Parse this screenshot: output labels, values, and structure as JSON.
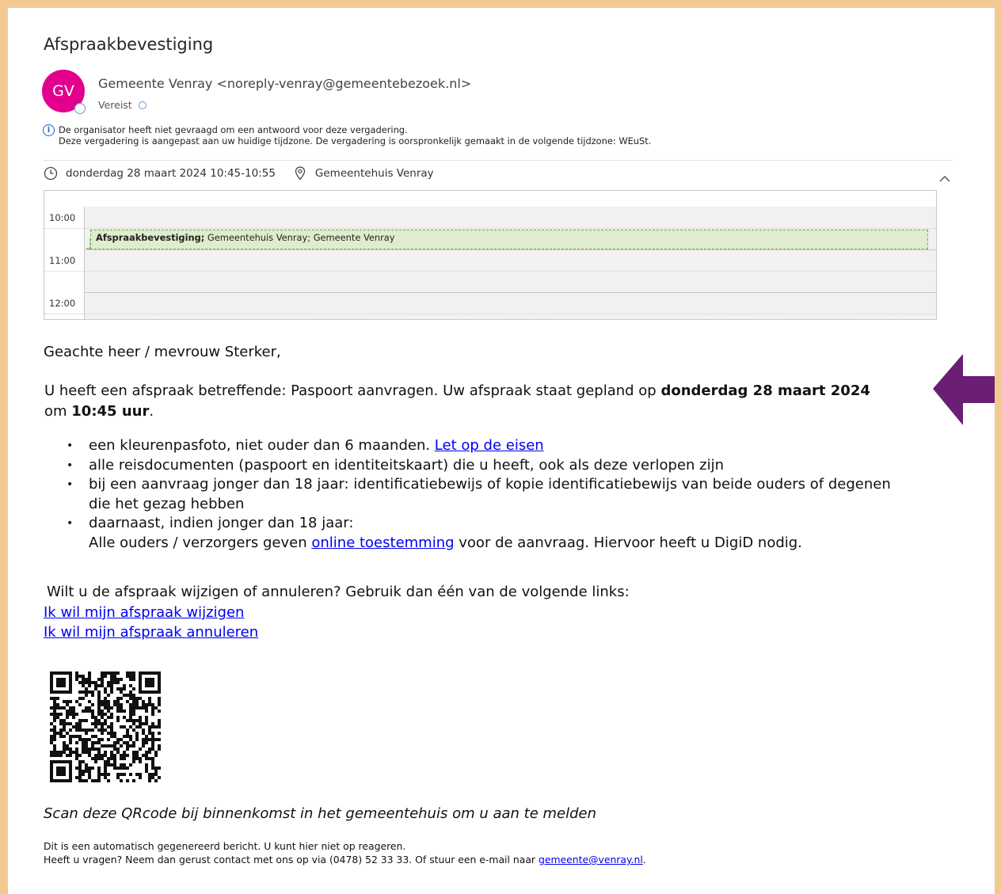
{
  "email": {
    "subject": "Afspraakbevestiging",
    "avatar_initials": "GV",
    "avatar_color": "#e3008c",
    "sender": "Gemeente Venray <noreply-venray@gemeentebezoek.nl>",
    "required_label": "Vereist",
    "info_line1": "De organisator heeft niet gevraagd om een antwoord voor deze vergadering.",
    "info_line2": "Deze vergadering is aangepast aan uw huidige tijdzone. De vergadering is oorspronkelijk gemaakt in de volgende tijdzone: WEuSt.",
    "datetime": "donderdag 28 maart 2024 10:45-10:55",
    "location": "Gemeentehuis Venray"
  },
  "calendar": {
    "times": [
      "10:00",
      "11:00",
      "12:00"
    ],
    "event_title": "Afspraakbevestiging;",
    "event_rest": " Gemeentehuis Venray; Gemeente Venray",
    "event_color": "#dfeccd"
  },
  "body": {
    "greeting": "Geachte heer / mevrouw Sterker,",
    "para_part1": "U heeft een afspraak betreffende: Paspoort aanvragen. Uw afspraak staat gepland op ",
    "para_bold_date": "donderdag 28 maart 2024",
    "para_part2": "om ",
    "para_bold_time": "10:45 uur",
    "para_part3": ".",
    "bullet1_text": "een kleurenpasfoto, niet ouder dan 6 maanden. ",
    "bullet1_link": "Let op de eisen",
    "bullet2_text": "alle reisdocumenten (paspoort en identiteitskaart) die u heeft, ook als deze verlopen zijn",
    "bullet3_line1": "bij een aanvraag jonger dan 18 jaar: identificatiebewijs of kopie identificatiebewijs van beide ouders of degenen",
    "bullet3_line2": "die het gezag hebben",
    "bullet4_line1": "daarnaast, indien jonger dan 18 jaar:",
    "bullet4_line2_pre": "Alle ouders / verzorgers geven ",
    "bullet4_link": "online toestemming",
    "bullet4_line2_post": " voor de aanvraag. Hiervoor heeft u DigiD nodig.",
    "change_question": "Wilt u de afspraak wijzigen of annuleren? Gebruik dan één van de volgende links:",
    "link_change": "Ik wil mijn afspraak wijzigen",
    "link_cancel": "Ik wil mijn afspraak annuleren",
    "scan_text": "Scan deze QRcode bij binnenkomst in het gemeentehuis om u aan te melden",
    "footer_line1": "Dit is een automatisch gegenereerd bericht. U kunt hier niet op reageren.",
    "footer_line2_pre": "Heeft u vragen? Neem dan gerust contact met ons op via (0478) 52 33 33. Of stuur een e-mail naar ",
    "footer_email": "gemeente@venray.nl",
    "footer_line2_post": "."
  },
  "colors": {
    "frame_border": "#f3c992",
    "arrow": "#6a1e74",
    "link": "#0000ee"
  }
}
